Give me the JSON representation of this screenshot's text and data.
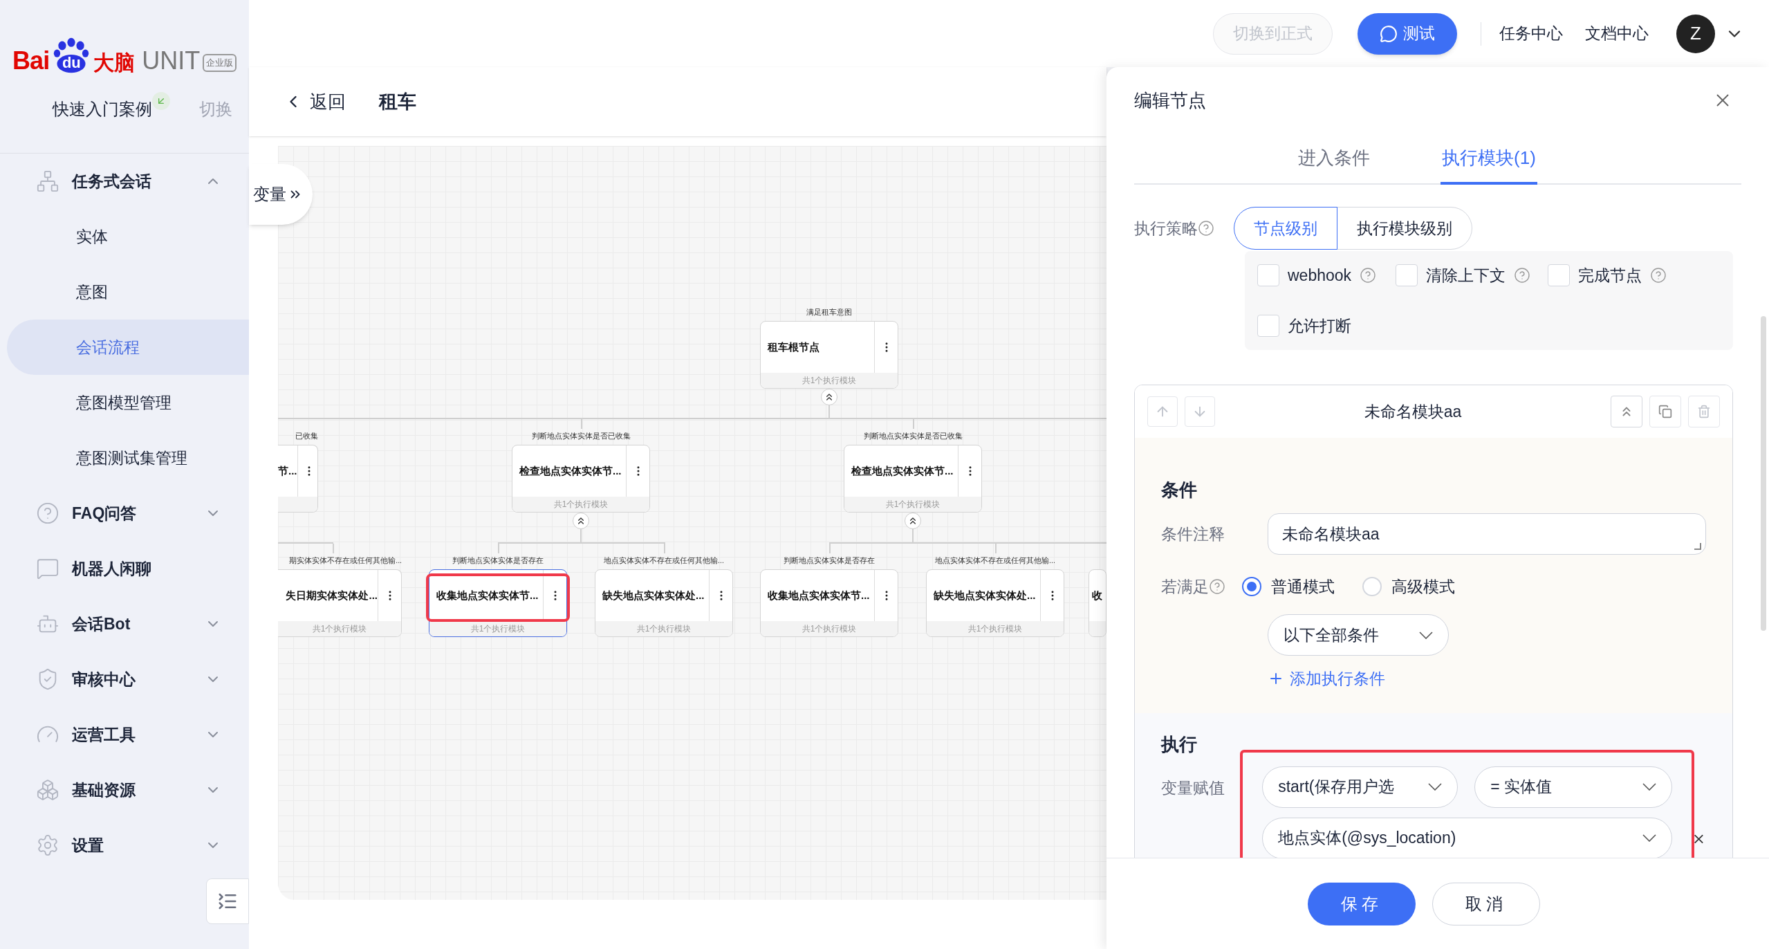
{
  "logo": {
    "brand_a": "Bai",
    "brand_b": "du",
    "brand_c": "大脑",
    "product": "UNIT",
    "edition": "企业版"
  },
  "project": {
    "name": "快速入门案例",
    "switch": "切换"
  },
  "nav": [
    {
      "kind": "group",
      "label": "任务式会话",
      "expanded": true,
      "children": [
        {
          "label": "实体",
          "selected": false
        },
        {
          "label": "意图",
          "selected": false
        },
        {
          "label": "会话流程",
          "selected": true
        },
        {
          "label": "意图模型管理",
          "selected": false
        },
        {
          "label": "意图测试集管理",
          "selected": false
        }
      ]
    },
    {
      "kind": "group",
      "label": "FAQ问答",
      "expanded": false
    },
    {
      "kind": "link",
      "label": "机器人闲聊"
    },
    {
      "kind": "group",
      "label": "会话Bot",
      "expanded": false
    },
    {
      "kind": "group",
      "label": "审核中心",
      "expanded": false
    },
    {
      "kind": "group",
      "label": "运营工具",
      "expanded": false
    },
    {
      "kind": "group",
      "label": "基础资源",
      "expanded": false
    },
    {
      "kind": "group",
      "label": "设置",
      "expanded": false
    }
  ],
  "topbar": {
    "switch_button": {
      "label": "切换到正式",
      "disabled": true
    },
    "test_button": "测试",
    "links": [
      "任务中心",
      "文档中心"
    ],
    "avatar": "Z"
  },
  "page": {
    "back": "返回",
    "title": "租车",
    "variables_tab": "变量"
  },
  "flow": {
    "nodes": [
      {
        "label": "满足租车意图",
        "title": "租车根节点",
        "footer": "共1个执行模块",
        "selected": false,
        "highlighted": false,
        "collapse": true
      },
      {
        "label": "已收集",
        "title": "节...",
        "selected": false,
        "highlighted": false,
        "collapse": false
      },
      {
        "label": "判断地点实体实体是否已收集",
        "title": "检查地点实体实体节...",
        "footer": "共1个执行模块",
        "selected": false,
        "highlighted": false,
        "collapse": true
      },
      {
        "label": "判断地点实体实体是否已收集",
        "title": "检查地点实体实体节...",
        "footer": "共1个执行模块",
        "selected": false,
        "highlighted": false,
        "collapse": true
      },
      {
        "label": "期实体实体不存在或任何其他输...",
        "title": "失日期实体实体处...",
        "footer": "共1个执行模块",
        "selected": false,
        "highlighted": false,
        "collapse": false
      },
      {
        "label": "判断地点实体实体是否存在",
        "title": "收集地点实体实体节...",
        "footer": "共1个执行模块",
        "selected": true,
        "highlighted": true,
        "collapse": false
      },
      {
        "label": "地点实体实体不存在或任何其他输...",
        "title": "缺失地点实体实体处...",
        "footer": "共1个执行模块",
        "selected": false,
        "highlighted": false,
        "collapse": false
      },
      {
        "label": "判断地点实体实体是否存在",
        "title": "收集地点实体实体节...",
        "footer": "共1个执行模块",
        "selected": false,
        "highlighted": false,
        "collapse": false
      },
      {
        "label": "地点实体实体不存在或任何其他输...",
        "title": "缺失地点实体实体处...",
        "footer": "共1个执行模块",
        "selected": false,
        "highlighted": false,
        "collapse": false
      },
      {
        "title": "收",
        "selected": false,
        "highlighted": false,
        "collapse": false
      }
    ]
  },
  "panel": {
    "title": "编辑节点",
    "tabs": [
      {
        "label": "进入条件",
        "selected": false
      },
      {
        "label": "执行模块(1)",
        "selected": true
      }
    ],
    "strategy": {
      "label": "执行策略",
      "options": [
        {
          "label": "节点级别",
          "selected": true
        },
        {
          "label": "执行模块级别",
          "selected": false
        }
      ]
    },
    "options": [
      {
        "label": "webhook",
        "checked": false,
        "help": true
      },
      {
        "label": "清除上下文",
        "checked": false,
        "help": true
      },
      {
        "label": "完成节点",
        "checked": false,
        "help": true
      },
      {
        "label": "允许打断",
        "checked": false,
        "help": false
      }
    ],
    "module": {
      "title": "未命名模块aa",
      "condition": {
        "heading": "条件",
        "note_label": "条件注释",
        "note_value": "未命名模块aa",
        "match_label": "若满足",
        "modes": [
          {
            "label": "普通模式",
            "selected": true
          },
          {
            "label": "高级模式",
            "selected": false
          }
        ],
        "scope": "以下全部条件",
        "add": "添加执行条件"
      },
      "execute": {
        "heading": "执行",
        "highlighted": true,
        "assign_label": "变量赋值",
        "variable": "start(保存用户选",
        "operator": "= 实体值",
        "value": "地点实体(@sys_location)"
      }
    },
    "save": "保存",
    "cancel": "取消"
  }
}
